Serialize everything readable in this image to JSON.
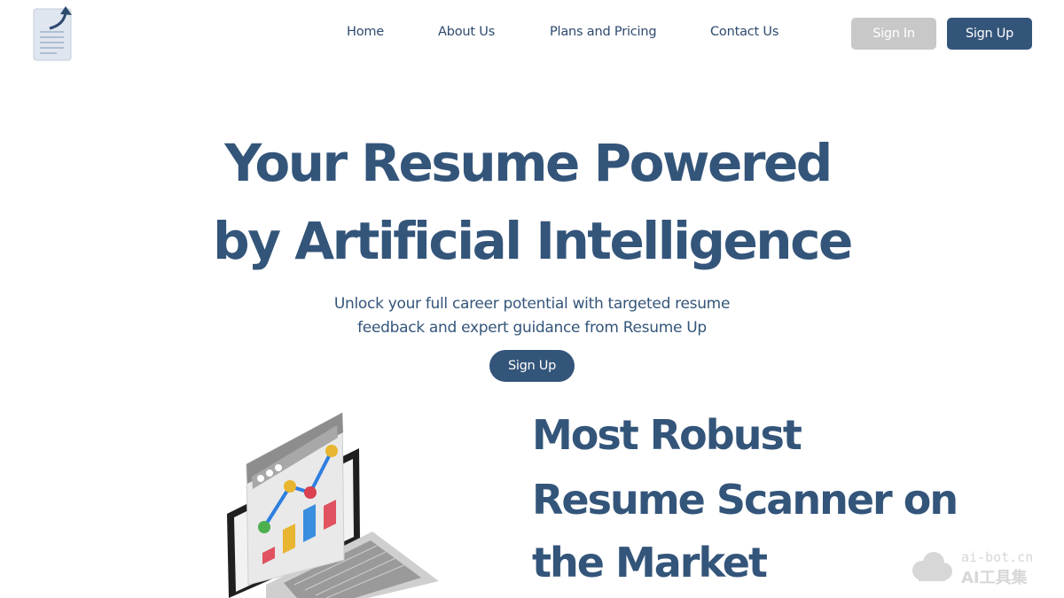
{
  "header": {
    "logo_icon": "resume-arrow-up-icon",
    "nav": [
      {
        "label": "Home"
      },
      {
        "label": "About Us"
      },
      {
        "label": "Plans and Pricing"
      },
      {
        "label": "Contact Us"
      }
    ],
    "sign_in_label": "Sign In",
    "sign_up_label": "Sign Up"
  },
  "hero": {
    "title_line1": "Your Resume Powered",
    "title_line2": "by Artificial Intelligence",
    "subtitle_line1": "Unlock your full career potential with targeted resume",
    "subtitle_line2": "feedback and expert guidance from Resume Up",
    "cta_label": "Sign Up"
  },
  "feature": {
    "illustration_icon": "laptop-analytics-icon",
    "title_line1": "Most Robust",
    "title_line2": "Resume Scanner on",
    "title_line3": "the Market"
  },
  "watermark": {
    "icon": "cloud-logo-icon",
    "line1": "ai-bot.cn",
    "line2": "AI工具集"
  },
  "colors": {
    "brand": "#34557a",
    "muted_button": "#c8c8c8",
    "background": "#ffffff"
  }
}
